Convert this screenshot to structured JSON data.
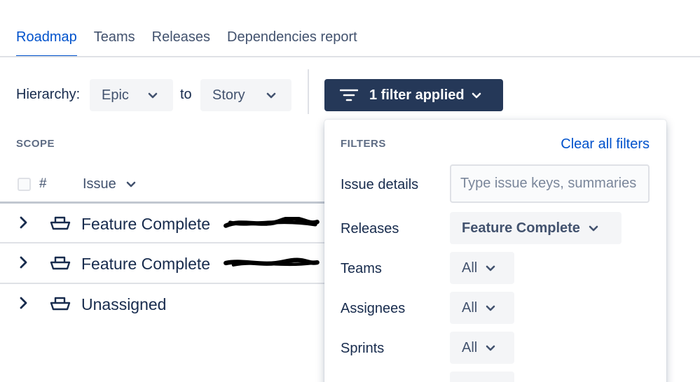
{
  "tabs": [
    {
      "label": "Roadmap",
      "active": true
    },
    {
      "label": "Teams",
      "active": false
    },
    {
      "label": "Releases",
      "active": false
    },
    {
      "label": "Dependencies report",
      "active": false
    }
  ],
  "toolbar": {
    "hierarchy_label": "Hierarchy:",
    "hierarchy_from": "Epic",
    "to_label": "to",
    "hierarchy_to": "Story",
    "filter_button_label": "1 filter applied"
  },
  "scope": {
    "label": "SCOPE",
    "hash_label": "#",
    "issue_column_label": "Issue",
    "rows": [
      {
        "label": "Feature Complete",
        "redacted": true
      },
      {
        "label": "Feature Complete",
        "redacted": true
      },
      {
        "label": "Unassigned",
        "redacted": false
      }
    ]
  },
  "filters": {
    "title": "FILTERS",
    "clear_label": "Clear all filters",
    "issue_details_label": "Issue details",
    "issue_details_placeholder": "Type issue keys, summaries",
    "releases_label": "Releases",
    "releases_value": "Feature Complete",
    "teams_label": "Teams",
    "teams_value": "All",
    "assignees_label": "Assignees",
    "assignees_value": "All",
    "sprints_label": "Sprints",
    "sprints_value": "All"
  },
  "colors": {
    "accent": "#0052cc",
    "filter_button_bg": "#253858",
    "text": "#172b4d"
  }
}
